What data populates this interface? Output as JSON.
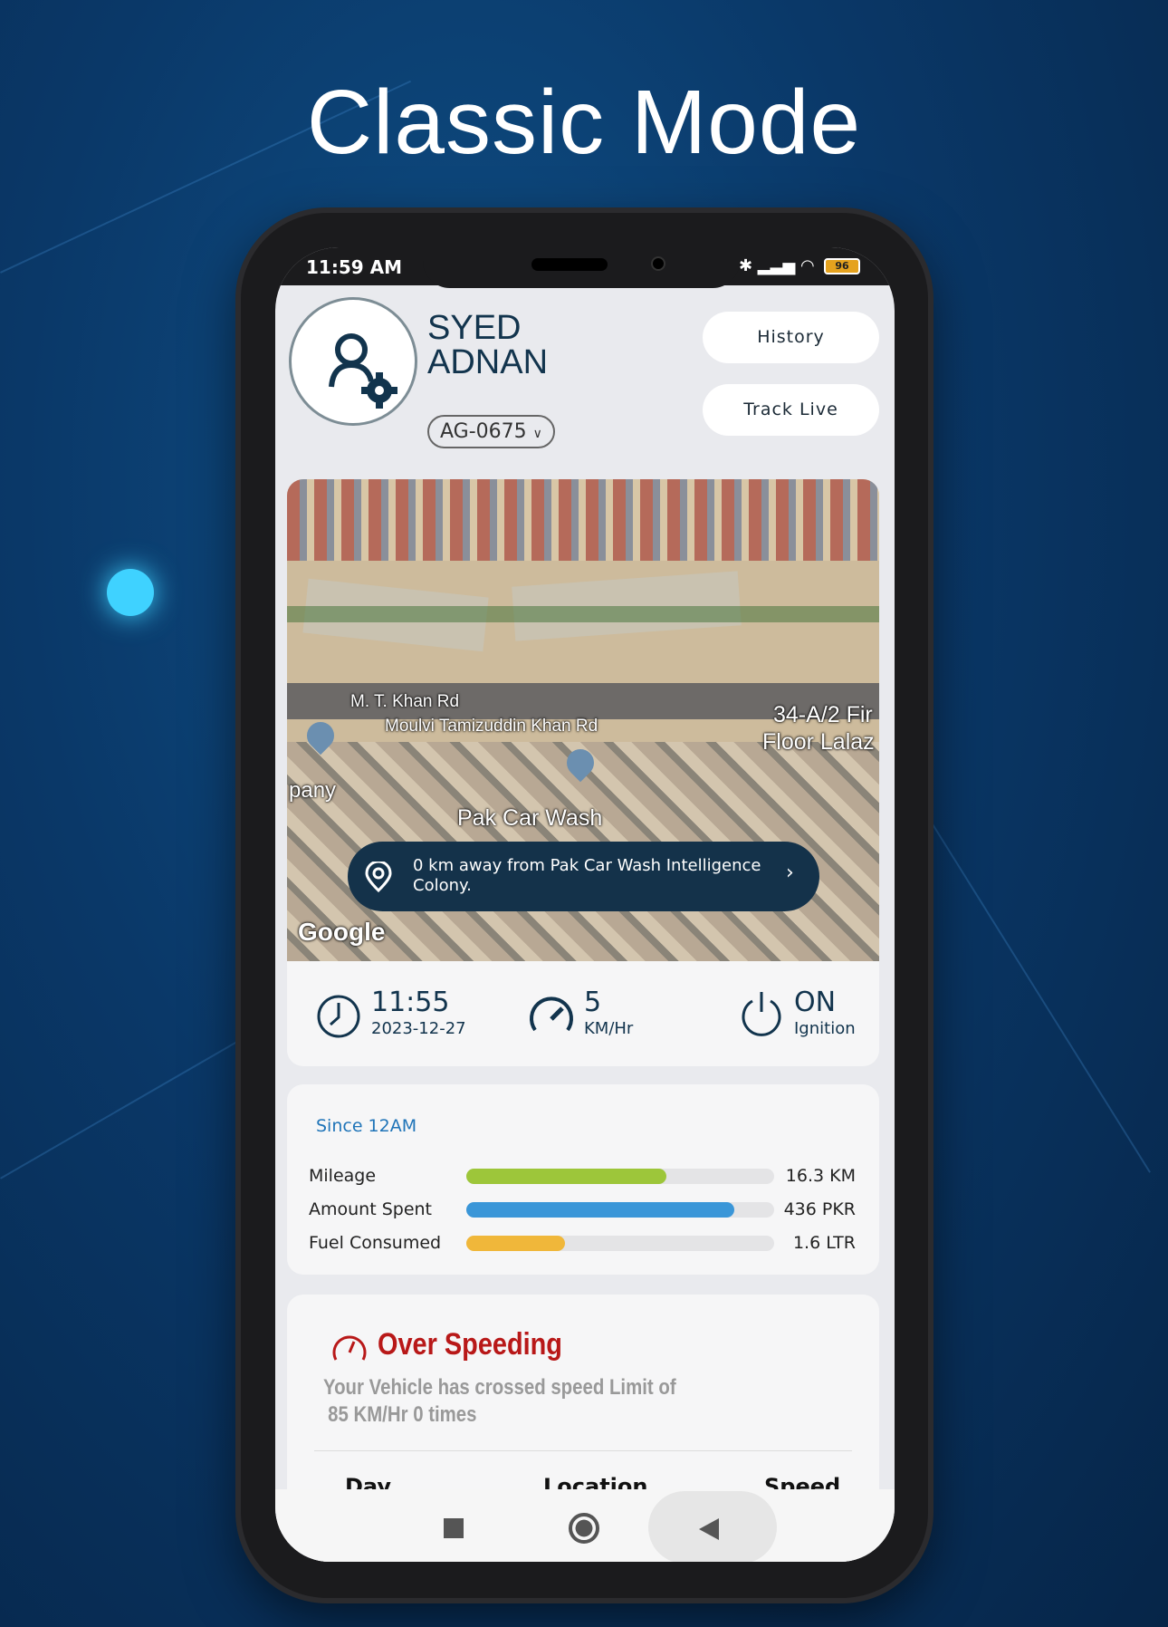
{
  "headline": "Classic Mode",
  "status_bar": {
    "time": "11:59 AM",
    "battery": "96"
  },
  "profile": {
    "first_name": "SYED",
    "last_name": "ADNAN",
    "vehicle": "AG-0675"
  },
  "buttons": {
    "history": "History",
    "track_live": "Track Live"
  },
  "map": {
    "labels": [
      "M. T. Khan Rd",
      "Moulvi Tamizuddin Khan Rd",
      "34-A/2 Fir",
      "Floor Lalaz",
      "pany",
      "Pak Car Wash"
    ],
    "attribution": "Google",
    "location_text": "0 km away from Pak Car Wash Intelligence Colony."
  },
  "info": {
    "time": "11:55",
    "date": "2023-12-27",
    "speed": "5",
    "speed_unit": "KM/Hr",
    "ignition": "ON",
    "ignition_label": "Ignition"
  },
  "summary": {
    "title": "Since 12AM",
    "rows": [
      {
        "label": "Mileage",
        "value": "16.3 KM",
        "fill": 0.65,
        "color": "#9dc63a"
      },
      {
        "label": "Amount Spent",
        "value": "436 PKR",
        "fill": 0.87,
        "color": "#3a96d8"
      },
      {
        "label": "Fuel Consumed",
        "value": "1.6 LTR",
        "fill": 0.32,
        "color": "#f0b73a"
      }
    ]
  },
  "over_speeding": {
    "title": "Over Speeding",
    "message_line1": "Your Vehicle has crossed speed Limit of",
    "message_line2": "85 KM/Hr 0 times",
    "columns": [
      "Day",
      "Location",
      "Speed"
    ]
  },
  "colors": {
    "accent_blue": "#1f74b8",
    "danger": "#b81818",
    "navy": "#12344d"
  }
}
